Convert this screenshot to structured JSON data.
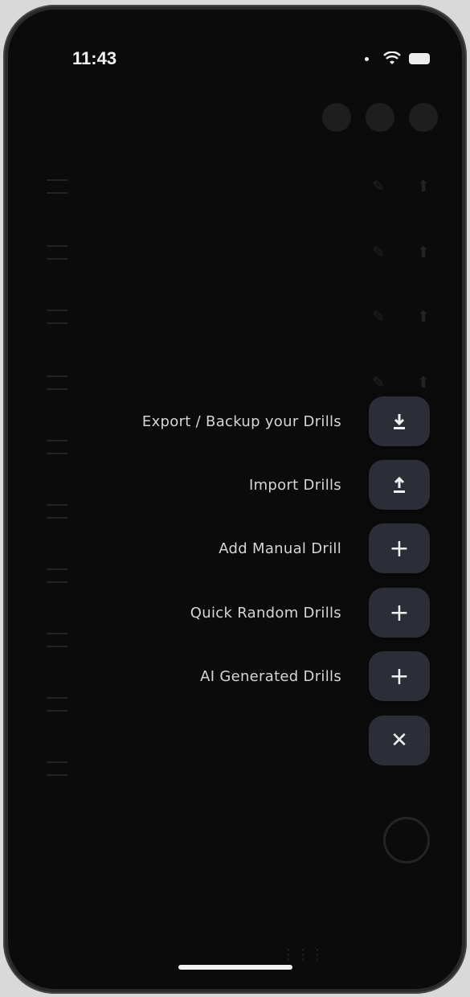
{
  "status_bar": {
    "time": "11:43"
  },
  "fab_menu": {
    "items": [
      {
        "label": "Export / Backup your Drills",
        "icon": "download-icon"
      },
      {
        "label": "Import Drills",
        "icon": "upload-icon"
      },
      {
        "label": "Add Manual Drill",
        "icon": "plus-icon"
      },
      {
        "label": "Quick Random Drills",
        "icon": "plus-icon"
      },
      {
        "label": "AI Generated Drills",
        "icon": "plus-icon"
      }
    ],
    "close_icon": "close-icon"
  }
}
